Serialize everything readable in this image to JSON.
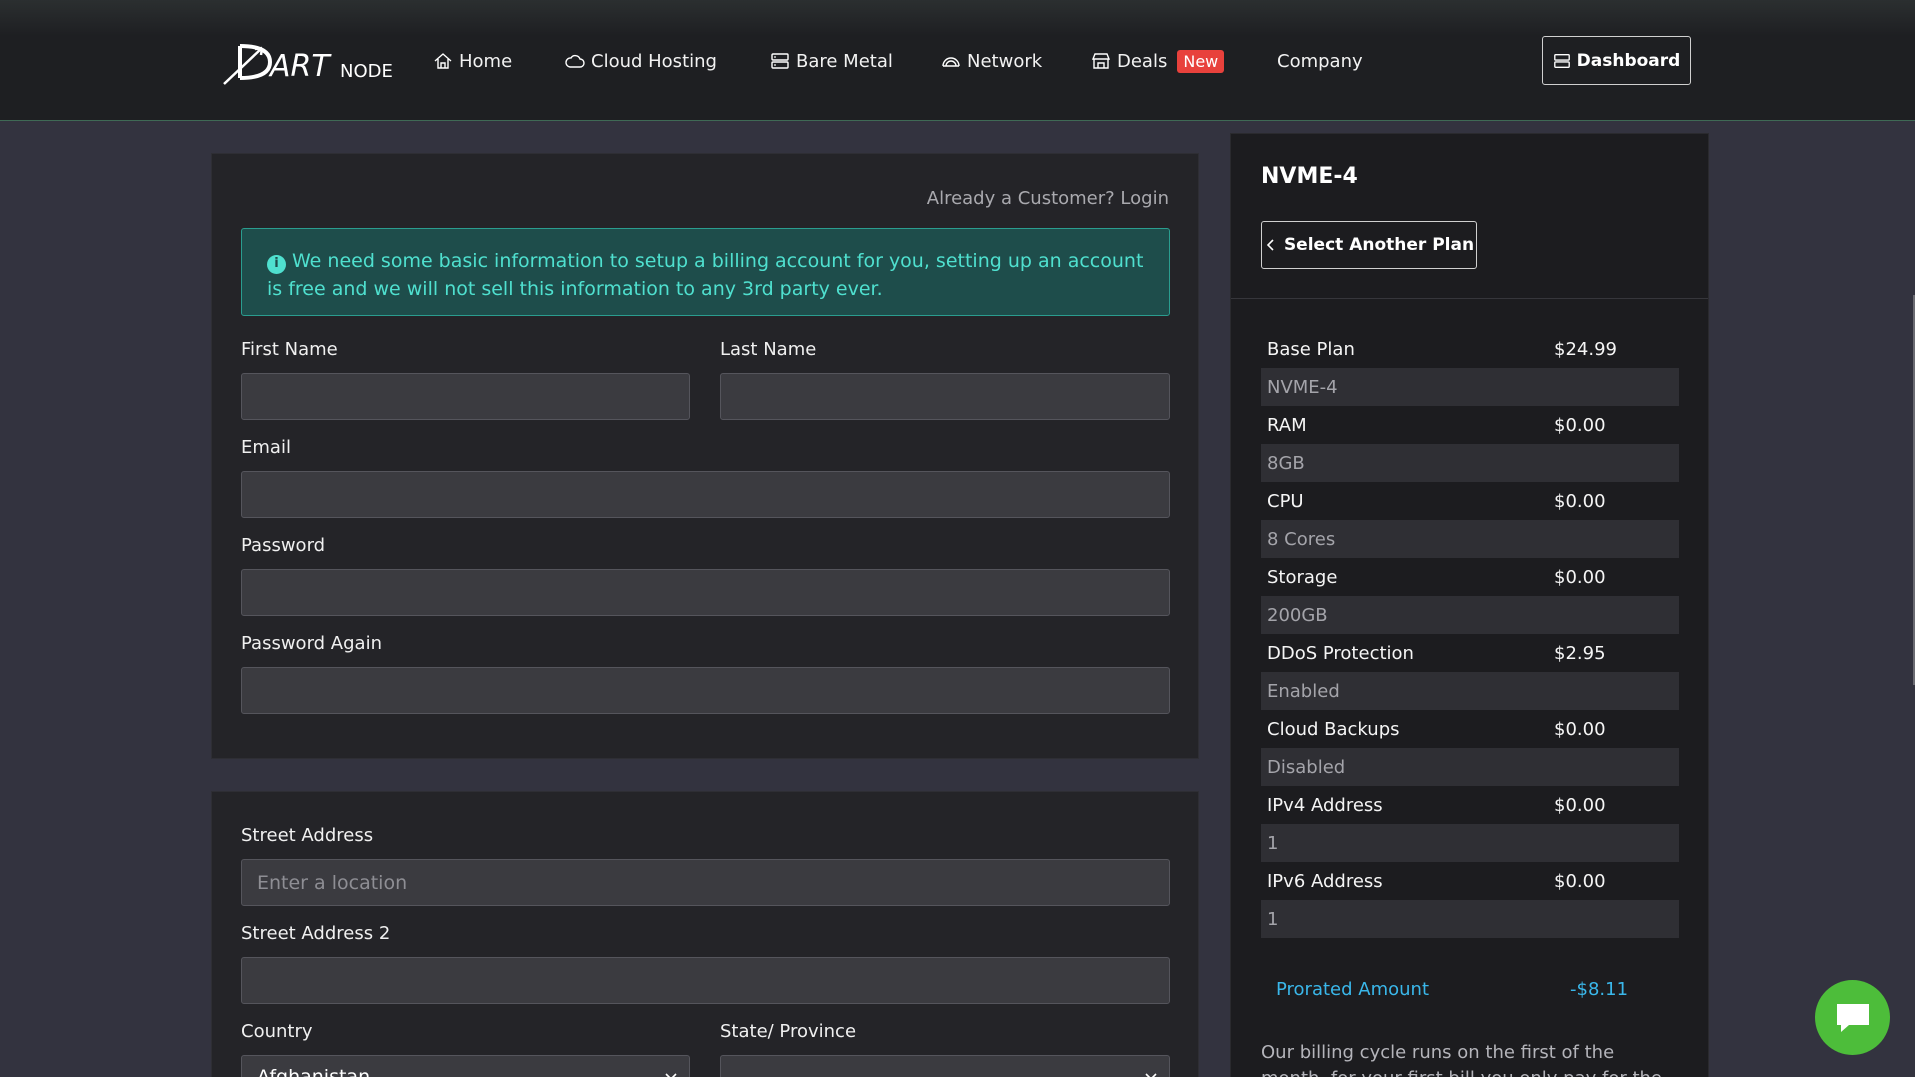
{
  "nav": {
    "logo_text": "DARTNODE",
    "items": [
      {
        "label": "Home",
        "icon": "home-icon"
      },
      {
        "label": "Cloud Hosting",
        "icon": "cloud-icon"
      },
      {
        "label": "Bare Metal",
        "icon": "server-icon"
      },
      {
        "label": "Network",
        "icon": "network-icon"
      },
      {
        "label": "Deals",
        "icon": "shop-icon",
        "badge": "New"
      },
      {
        "label": "Company"
      }
    ],
    "dashboard_label": "Dashboard"
  },
  "form": {
    "login_prompt": "Already a Customer? Login",
    "info_message": "We need some basic information to setup a billing account for you, setting up an account is free and we will not sell this information to any 3rd party ever.",
    "first_name": {
      "label": "First Name",
      "value": ""
    },
    "last_name": {
      "label": "Last Name",
      "value": ""
    },
    "email": {
      "label": "Email",
      "value": ""
    },
    "password": {
      "label": "Password",
      "value": ""
    },
    "password_again": {
      "label": "Password Again",
      "value": ""
    },
    "street_address": {
      "label": "Street Address",
      "placeholder": "Enter a location"
    },
    "street_address_2": {
      "label": "Street Address 2",
      "value": ""
    },
    "country": {
      "label": "Country",
      "selected": "Afghanistan"
    },
    "state": {
      "label": "State/ Province",
      "selected": ""
    }
  },
  "summary": {
    "plan_name": "NVME-4",
    "select_another_label": "Select Another Plan",
    "rows": [
      {
        "label": "Base Plan",
        "price": "$24.99",
        "value": "NVME-4"
      },
      {
        "label": "RAM",
        "price": "$0.00",
        "value": "8GB"
      },
      {
        "label": "CPU",
        "price": "$0.00",
        "value": "8 Cores"
      },
      {
        "label": "Storage",
        "price": "$0.00",
        "value": "200GB"
      },
      {
        "label": "DDoS Protection",
        "price": "$2.95",
        "value": "Enabled"
      },
      {
        "label": "Cloud Backups",
        "price": "$0.00",
        "value": "Disabled"
      },
      {
        "label": "IPv4 Address",
        "price": "$0.00",
        "value": "1"
      },
      {
        "label": "IPv6 Address",
        "price": "$0.00",
        "value": "1"
      }
    ],
    "prorated_label": "Prorated Amount",
    "prorated_value": "-$8.11",
    "billing_note": "Our billing cycle runs on the first of the month, for your first bill you only pay for the time"
  },
  "colors": {
    "accent_teal": "#4fe0cf",
    "badge_red": "#e8413c",
    "prorated_blue": "#3ab7ea",
    "chat_green": "#4dbd3a"
  }
}
